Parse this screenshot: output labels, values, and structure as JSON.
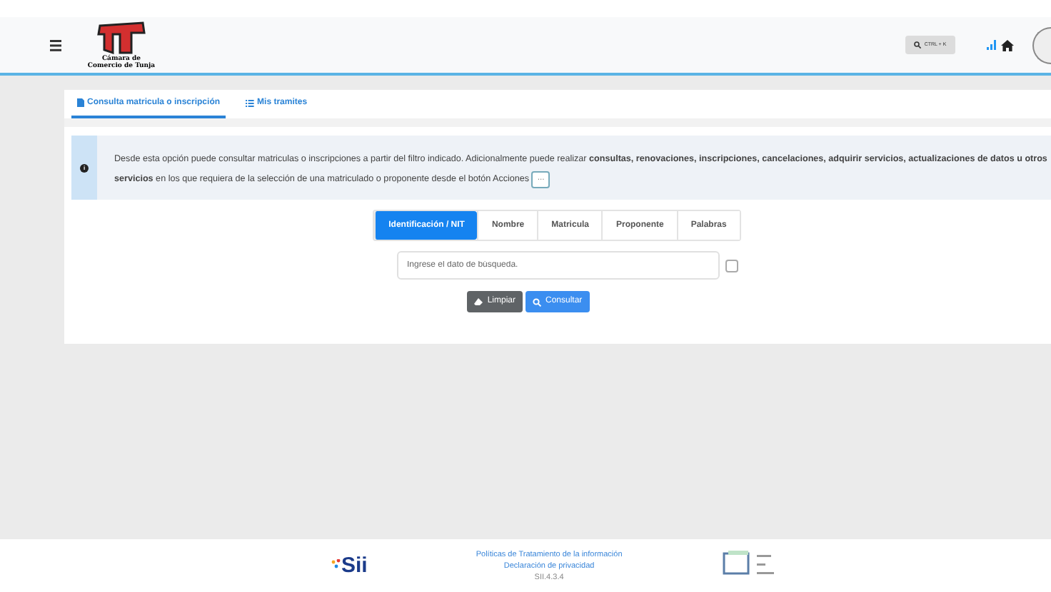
{
  "header": {
    "logo_text": "Cámara de Comercio de Tunja",
    "search_shortcut": "CTRL + K"
  },
  "tabs": [
    {
      "label": "Consulta matricula o inscripción",
      "selected": true
    },
    {
      "label": "Mis tramites",
      "selected": false
    }
  ],
  "info": {
    "icon": "i",
    "text": "Desde esta opción puede consultar matriculas o inscripciones a partir del filtro indicado. Adicionalmente puede realizar **consultas, renovaciones, inscripciones, cancelaciones, adquirir servicios, actualizaciones de datos u otros servicios** en los que requiera de la selección de una matriculado o proponente desde el botón Acciones",
    "actions_button": "···"
  },
  "search_tabs": [
    {
      "label": "Identificación / NIT",
      "selected": true
    },
    {
      "label": "Nombre",
      "selected": false
    },
    {
      "label": "Matricula",
      "selected": false
    },
    {
      "label": "Proponente",
      "selected": false
    },
    {
      "label": "Palabras",
      "selected": false
    }
  ],
  "search_field": {
    "placeholder": "Ingrese el dato de búsqueda.",
    "checked": false
  },
  "buttons": [
    {
      "label": "Limpiar",
      "kind": "clear"
    },
    {
      "label": "Consultar",
      "kind": "search"
    }
  ],
  "footer": {
    "logo_text": "Sii",
    "links": [
      "Políticas de Tratamiento de la información",
      "Declaración de privacidad"
    ],
    "version": "SII.4.3.4"
  }
}
